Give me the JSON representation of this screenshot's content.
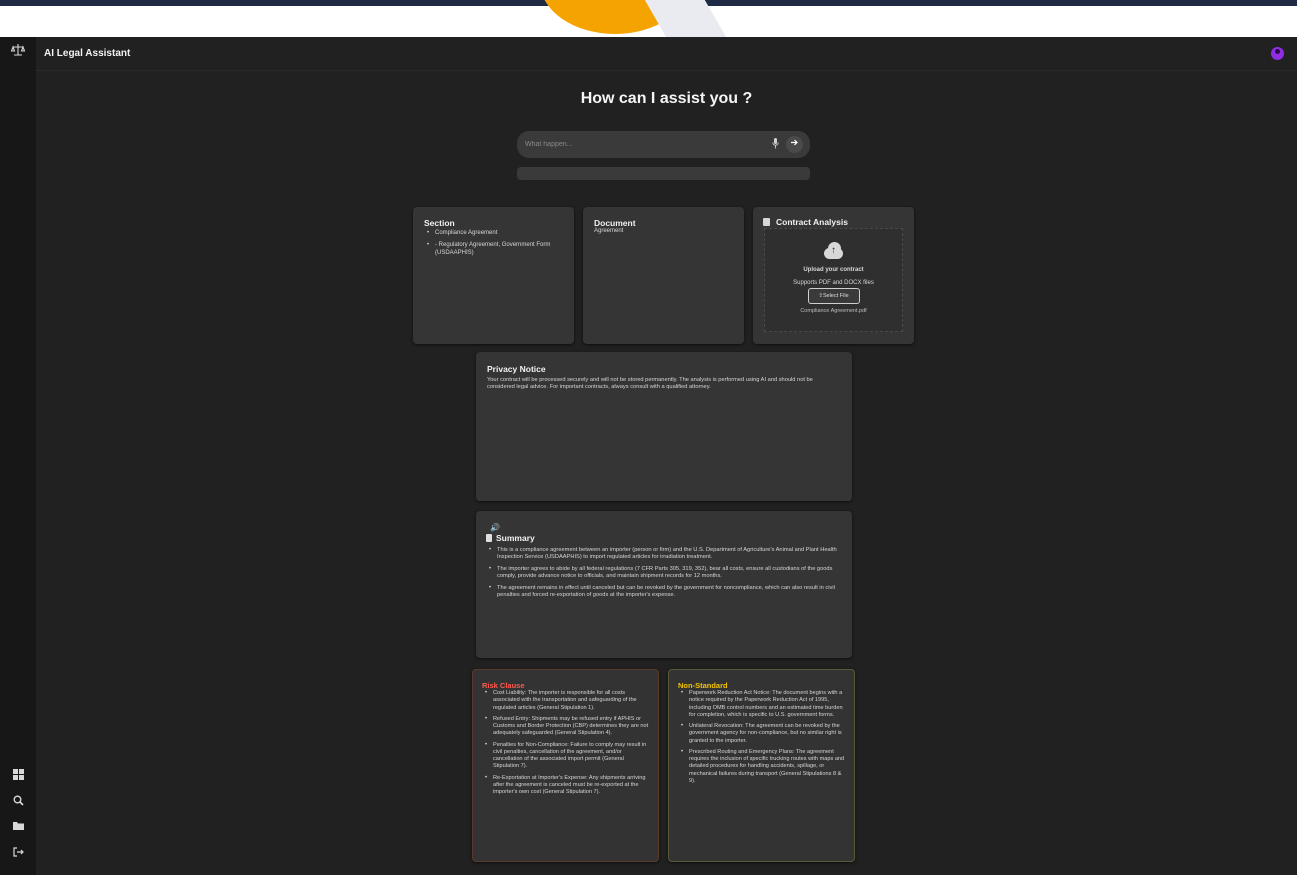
{
  "colors": {
    "app_bg": "#212121",
    "sidebar_bg": "#171717",
    "card_bg": "#353535",
    "accent_avatar": "#8e2de2",
    "risk_title": "#ff5a4e",
    "nonstandard_title": "#f5c400"
  },
  "sidebar": {
    "top_icon": "scale-balance-icon",
    "bottom_icons": [
      "dashboard-icon",
      "search-icon",
      "folder-icon",
      "logout-icon"
    ]
  },
  "header": {
    "title": "AI Legal Assistant",
    "avatar_icon": "user-avatar-icon"
  },
  "hero": {
    "title": "How can I assist you ?"
  },
  "search": {
    "placeholder": "What happen...",
    "mic_icon": "microphone-icon",
    "send_icon": "arrow-right-icon"
  },
  "section_card": {
    "title": "Section",
    "items": [
      "Compliance Agreement",
      "- Regulatory Agreement, Government Form (USDAAPHIS)"
    ]
  },
  "document_card": {
    "title": "Document",
    "value": "Agreement"
  },
  "contract_card": {
    "title": "Contract Analysis",
    "upload_title": "Upload your contract",
    "upload_sub": "Supports PDF and DOCX files",
    "select_label": "Select File",
    "file_name": "Compliance Agreement.pdf"
  },
  "privacy": {
    "title": "Privacy Notice",
    "text": "Your contract will be processed securely and will not be stored permanently. The analysis is performed using AI and should not be considered legal advice. For important contracts, always consult with a qualified attorney."
  },
  "summary": {
    "title": "Summary",
    "items": [
      "This is a compliance agreement between an importer (person or firm) and the U.S. Department of Agriculture's Animal and Plant Health Inspection Service (USDAAPHIS) to import regulated articles for irradiation treatment.",
      "The importer agrees to abide by all federal regulations (7 CFR Parts 305, 319, 352), bear all costs, ensure all custodians of the goods comply, provide advance notice to officials, and maintain shipment records for 12 months.",
      "The agreement remains in effect until canceled but can be revoked by the government for noncompliance, which can also result in civil penalties and forced re-exportation of goods at the importer's expense."
    ]
  },
  "risk": {
    "title": "Risk Clause",
    "items": [
      "Cost Liability: The importer is responsible for all costs associated with the transportation and safeguarding of the regulated articles (General Stipulation 1).",
      "Refused Entry: Shipments may be refused entry if APHIS or Customs and Border Protection (CBP) determines they are not adequately safeguarded (General Stipulation 4).",
      "Penalties for Non-Compliance: Failure to comply may result in civil penalties, cancellation of the agreement, and/or cancellation of the associated import permit (General Stipulation 7).",
      "Re-Exportation at Importer's Expense: Any shipments arriving after the agreement is canceled must be re-exported at the importer's own cost (General Stipulation 7)."
    ]
  },
  "nonstandard": {
    "title": "Non-Standard",
    "items": [
      "Paperwork Reduction Act Notice: The document begins with a notice required by the Paperwork Reduction Act of 1995, including OMB control numbers and an estimated time burden for completion, which is specific to U.S. government forms.",
      "Unilateral Revocation: The agreement can be revoked by the government agency for non-compliance, but no similar right is granted to the importer.",
      "Prescribed Routing and Emergency Plans: The agreement requires the inclusion of specific trucking routes with maps and detailed procedures for handling accidents, spillage, or mechanical failures during transport (General Stipulations 8 & 9)."
    ]
  }
}
